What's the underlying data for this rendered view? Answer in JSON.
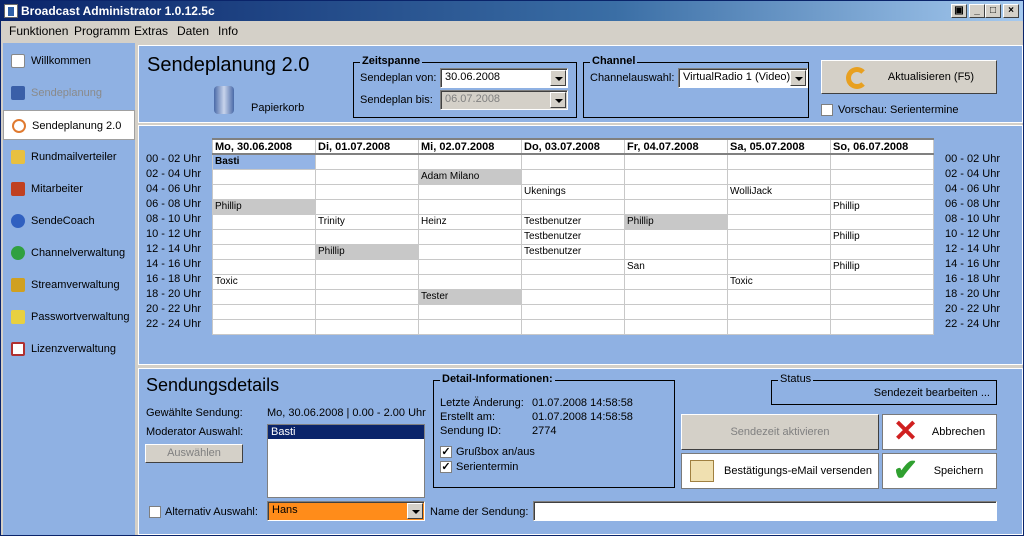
{
  "window": {
    "title": "Broadcast Administrator 1.0.12.5c",
    "buttons": [
      "▣",
      "_",
      "□",
      "×"
    ]
  },
  "menu": [
    "Funktionen",
    "Programm",
    "Extras",
    "Daten",
    "Info"
  ],
  "sidebar": {
    "items": [
      {
        "label": "Willkommen",
        "state": "normal",
        "icon": "page-icon",
        "color": "#ffffff"
      },
      {
        "label": "Sendeplanung",
        "state": "disabled",
        "icon": "chart-icon",
        "color": "#3a5fa8"
      },
      {
        "label": "Sendeplanung 2.0",
        "state": "active",
        "icon": "clock-icon",
        "color": "#e07a30"
      },
      {
        "label": "Rundmailverteiler",
        "state": "normal",
        "icon": "notepad-icon",
        "color": "#e8c040"
      },
      {
        "label": "Mitarbeiter",
        "state": "normal",
        "icon": "people-icon",
        "color": "#c04020"
      },
      {
        "label": "SendeCoach",
        "state": "normal",
        "icon": "stopwatch-icon",
        "color": "#3060c0"
      },
      {
        "label": "Channelverwaltung",
        "state": "normal",
        "icon": "globe-icon",
        "color": "#30a040"
      },
      {
        "label": "Streamverwaltung",
        "state": "normal",
        "icon": "speaker-icon",
        "color": "#d0a020"
      },
      {
        "label": "Passwortverwaltung",
        "state": "normal",
        "icon": "key-icon",
        "color": "#e8d040"
      },
      {
        "label": "Lizenzverwaltung",
        "state": "normal",
        "icon": "document-icon",
        "color": "#b03030"
      }
    ]
  },
  "header": {
    "title": "Sendeplanung 2.0",
    "trash_label": "Papierkorb",
    "zeitspanne": {
      "legend": "Zeitspanne",
      "von_label": "Sendeplan von:",
      "von_value": "30.06.2008",
      "bis_label": "Sendeplan bis:",
      "bis_value": "06.07.2008"
    },
    "channel": {
      "legend": "Channel",
      "label": "Channelauswahl:",
      "value": "VirtualRadio 1 (Video)"
    },
    "refresh_label": "Aktualisieren (F5)",
    "preview_label": "Vorschau: Serientermine"
  },
  "schedule": {
    "days": [
      "Mo, 30.06.2008",
      "Di, 01.07.2008",
      "Mi, 02.07.2008",
      "Do, 03.07.2008",
      "Fr, 04.07.2008",
      "Sa, 05.07.2008",
      "So, 06.07.2008"
    ],
    "slots": [
      "00 - 02 Uhr",
      "02 - 04 Uhr",
      "04 - 06 Uhr",
      "06 - 08 Uhr",
      "08 - 10 Uhr",
      "10 - 12 Uhr",
      "12 - 14 Uhr",
      "14 - 16 Uhr",
      "16 - 18 Uhr",
      "18 - 20 Uhr",
      "20 - 22 Uhr",
      "22 - 24 Uhr"
    ],
    "cells": [
      [
        {
          "t": "Basti",
          "s": "sel"
        },
        {
          "t": ""
        },
        {
          "t": ""
        },
        {
          "t": ""
        },
        {
          "t": ""
        },
        {
          "t": ""
        },
        {
          "t": ""
        }
      ],
      [
        {
          "t": ""
        },
        {
          "t": ""
        },
        {
          "t": "Adam Milano",
          "s": "gray"
        },
        {
          "t": ""
        },
        {
          "t": ""
        },
        {
          "t": ""
        },
        {
          "t": ""
        }
      ],
      [
        {
          "t": ""
        },
        {
          "t": ""
        },
        {
          "t": ""
        },
        {
          "t": "Ukenings"
        },
        {
          "t": ""
        },
        {
          "t": "WolliJack"
        },
        {
          "t": ""
        }
      ],
      [
        {
          "t": "Phillip",
          "s": "gray"
        },
        {
          "t": ""
        },
        {
          "t": ""
        },
        {
          "t": ""
        },
        {
          "t": ""
        },
        {
          "t": ""
        },
        {
          "t": "Phillip"
        }
      ],
      [
        {
          "t": ""
        },
        {
          "t": "Trinity"
        },
        {
          "t": "Heinz"
        },
        {
          "t": "Testbenutzer"
        },
        {
          "t": "Phillip",
          "s": "gray"
        },
        {
          "t": ""
        },
        {
          "t": ""
        }
      ],
      [
        {
          "t": ""
        },
        {
          "t": ""
        },
        {
          "t": ""
        },
        {
          "t": "Testbenutzer"
        },
        {
          "t": ""
        },
        {
          "t": ""
        },
        {
          "t": "Phillip"
        }
      ],
      [
        {
          "t": ""
        },
        {
          "t": "Phillip",
          "s": "gray"
        },
        {
          "t": ""
        },
        {
          "t": "Testbenutzer"
        },
        {
          "t": ""
        },
        {
          "t": ""
        },
        {
          "t": ""
        }
      ],
      [
        {
          "t": ""
        },
        {
          "t": ""
        },
        {
          "t": ""
        },
        {
          "t": ""
        },
        {
          "t": "San"
        },
        {
          "t": ""
        },
        {
          "t": "Phillip"
        }
      ],
      [
        {
          "t": "Toxic"
        },
        {
          "t": ""
        },
        {
          "t": ""
        },
        {
          "t": ""
        },
        {
          "t": ""
        },
        {
          "t": "Toxic"
        },
        {
          "t": ""
        }
      ],
      [
        {
          "t": ""
        },
        {
          "t": ""
        },
        {
          "t": "Tester",
          "s": "gray"
        },
        {
          "t": ""
        },
        {
          "t": ""
        },
        {
          "t": ""
        },
        {
          "t": ""
        }
      ],
      [
        {
          "t": ""
        },
        {
          "t": ""
        },
        {
          "t": ""
        },
        {
          "t": ""
        },
        {
          "t": ""
        },
        {
          "t": ""
        },
        {
          "t": ""
        }
      ],
      [
        {
          "t": ""
        },
        {
          "t": ""
        },
        {
          "t": ""
        },
        {
          "t": ""
        },
        {
          "t": ""
        },
        {
          "t": ""
        },
        {
          "t": ""
        }
      ]
    ]
  },
  "details": {
    "title": "Sendungsdetails",
    "sendung_label": "Gewählte Sendung:",
    "sendung_value": "Mo, 30.06.2008 | 0.00 - 2.00 Uhr",
    "moderator_label": "Moderator Auswahl:",
    "moderator_list": [
      "Basti"
    ],
    "auswaehlen_label": "Auswählen",
    "alt_label": "Alternativ Auswahl:",
    "alt_value": "Hans",
    "name_label": "Name der Sendung:",
    "name_value": "",
    "info": {
      "legend": "Detail-Informationen:",
      "rows": [
        {
          "k": "Letzte Änderung:",
          "v": "01.07.2008 14:58:58"
        },
        {
          "k": "Erstellt am:",
          "v": "01.07.2008 14:58:58"
        },
        {
          "k": "Sendung ID:",
          "v": "2774"
        }
      ],
      "grussbox_label": "Grußbox an/aus",
      "grussbox_checked": "✓",
      "serie_label": "Serientermin",
      "serie_checked": "✓"
    },
    "status": {
      "legend": "Status",
      "value": "Sendezeit bearbeiten ..."
    },
    "btn_activate": "Sendezeit aktivieren",
    "btn_cancel": "Abbrechen",
    "btn_mail": "Bestätigungs-eMail versenden",
    "btn_save": "Speichern"
  }
}
